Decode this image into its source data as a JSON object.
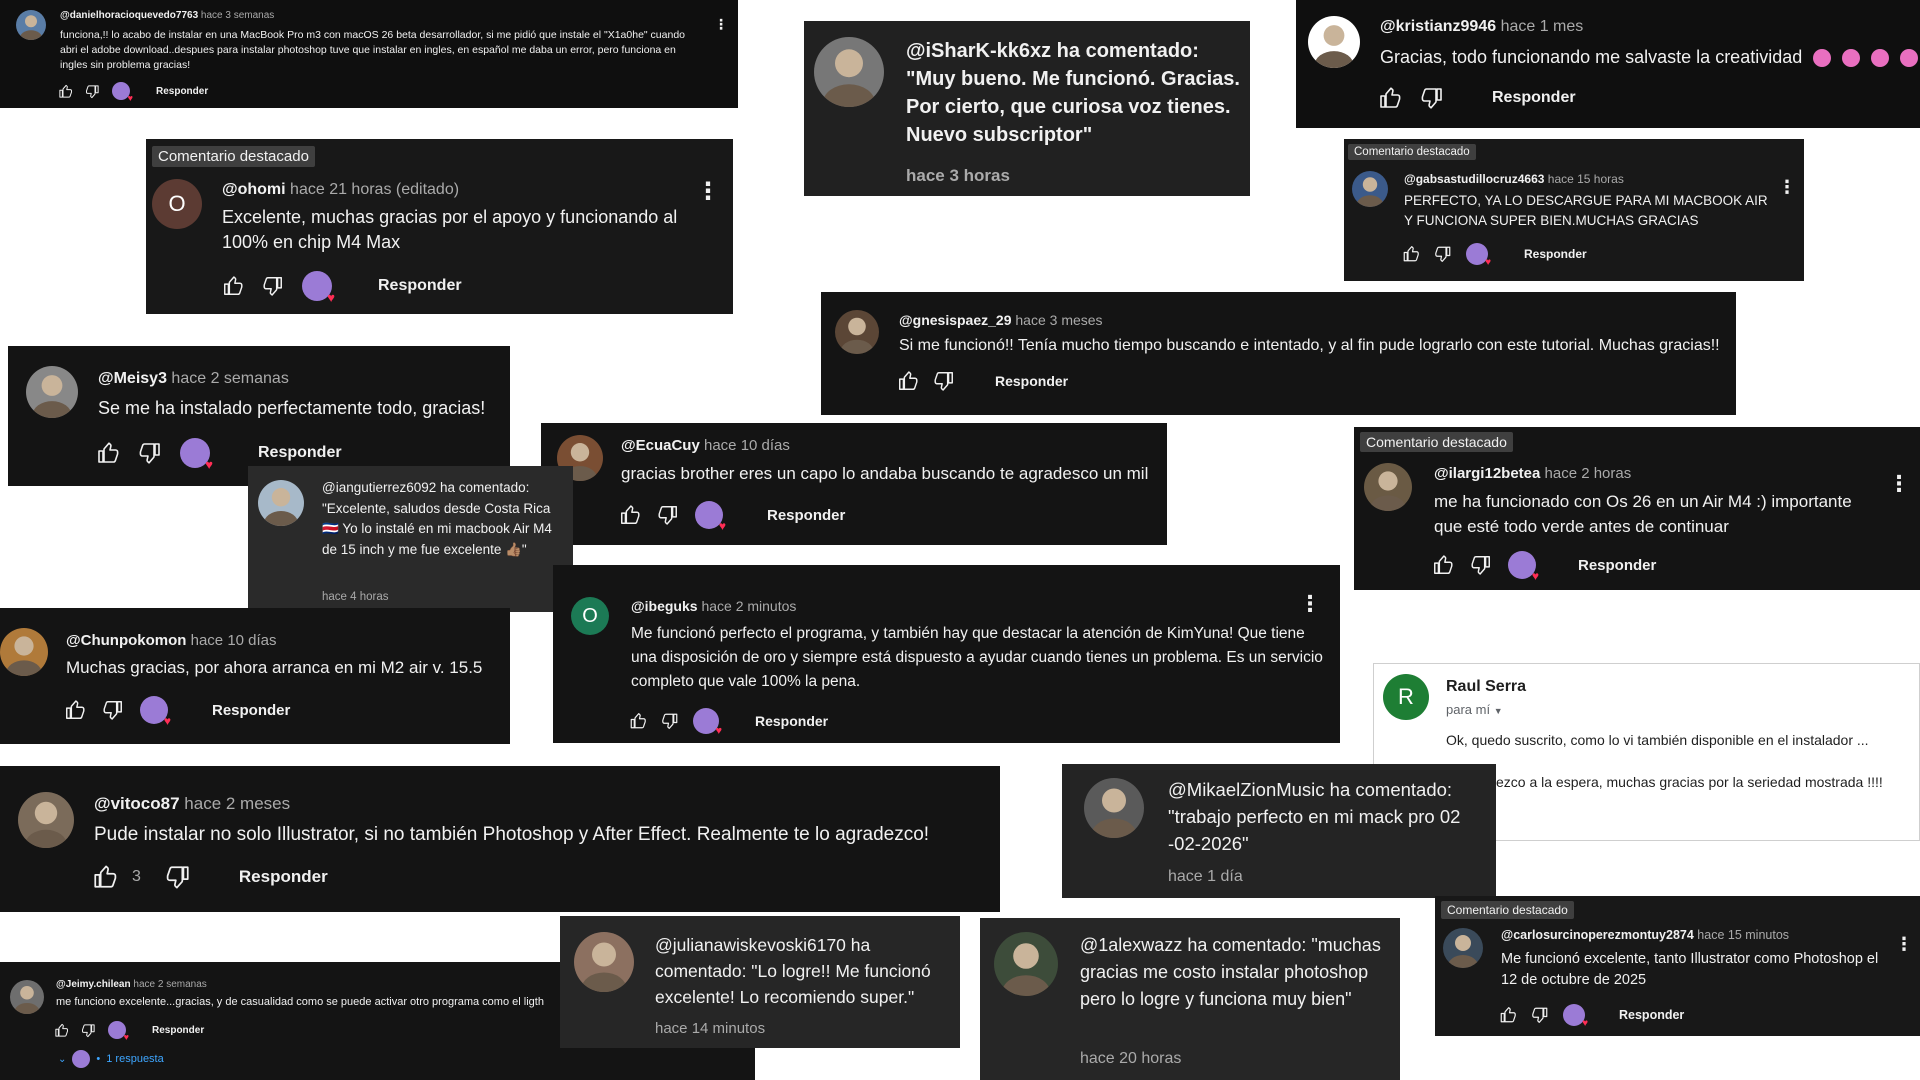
{
  "reply_label": "Responder",
  "featured_label": "Comentario destacado",
  "colors": {
    "card_bg": "#0f0f0f",
    "card_gray": "#212121",
    "time_gray": "#aaaaaa",
    "link_blue": "#3ea6ff",
    "badge_bg": "#3f3f3f"
  },
  "comments": {
    "c1": {
      "user": "@danielhoracioquevedo7763",
      "time": "hace 3 semanas",
      "text": "funciona,!! lo acabo de instalar en una MacBook Pro m3 con macOS 26 beta desarrollador, si me pidió que instale el \"X1a0he\" cuando abri el adobe download..despues para instalar photoshop tuve que instalar en ingles, en español me daba un error, pero funciona en ingles sin problema gracias!"
    },
    "c2": {
      "user": "@iSharK-kk6xz ha comentado: \"Muy bueno. Me funcionó. Gracias. Por cierto, que curiosa voz tienes. Nuevo subscriptor\"",
      "time": "hace 3 horas"
    },
    "c3": {
      "user": "@kristianz9946",
      "time": "hace 1 mes",
      "text": "Gracias, todo funcionando me salvaste la creatividad"
    },
    "c4": {
      "badge": "Comentario destacado",
      "avatar_letter": "O",
      "user": "@ohomi",
      "time": "hace 21 horas (editado)",
      "text": "Excelente, muchas gracias por el apoyo y funcionando al 100% en chip M4 Max"
    },
    "c5": {
      "badge": "Comentario destacado",
      "user": "@gabsastudillocruz4663",
      "time": "hace 15 horas",
      "text": "PERFECTO, YA LO DESCARGUE PARA MI MACBOOK AIR Y FUNCIONA SUPER BIEN.MUCHAS GRACIAS"
    },
    "c6": {
      "user": "@gnesispaez_29",
      "time": "hace 3 meses",
      "text": "Si me funcionó!! Tenía mucho tiempo buscando e intentado, y al fin pude lograrlo con este tutorial. Muchas gracias!!"
    },
    "c7": {
      "user": "@Meisy3",
      "time": "hace 2 semanas",
      "text": "Se me ha instalado perfectamente todo, gracias!"
    },
    "c8": {
      "text": "@iangutierrez6092 ha comentado: \"Excelente, saludos desde Costa Rica 🇨🇷 Yo lo instalé en mi macbook Air M4 de 15 inch y me fue excelente 👍🏽\"",
      "time": "hace 4 horas"
    },
    "c9": {
      "user": "@EcuaCuy",
      "time": "hace 10 días",
      "text": "gracias brother eres un capo lo andaba buscando te agradesco un mil"
    },
    "c10": {
      "badge": "Comentario destacado",
      "user": "@ilargi12betea",
      "time": "hace 2 horas",
      "text": "me ha funcionado con Os 26 en un Air M4 :) importante que esté todo verde antes de continuar"
    },
    "c11": {
      "user": "@Chunpokomon",
      "time": "hace 10 días",
      "text": "Muchas gracias, por ahora arranca en mi M2 air v. 15.5"
    },
    "c12": {
      "avatar_letter": "O",
      "user": "@ibeguks",
      "time": "hace 2 minutos",
      "text": "Me funcionó perfecto el programa, y también hay que destacar la atención de KimYuna! Que tiene una disposición de oro y siempre está dispuesto a ayudar cuando tienes un problema. Es un servicio completo que vale 100% la pena."
    },
    "c13": {
      "avatar_letter": "R",
      "sender": "Raul Serra",
      "to": "para mí",
      "line1": "Ok, quedo suscrito, como lo vi también disponible en el instalador ...",
      "line2": "ezco a la espera, muchas gracias por la seriedad mostrada !!!!"
    },
    "c14": {
      "user": "@vitoco87",
      "time": "hace 2 meses",
      "text": "Pude instalar no solo Illustrator, si no también Photoshop y After Effect. Realmente te lo agradezco!",
      "likes": "3"
    },
    "c15": {
      "text": "@MikaelZionMusic ha comentado: \"trabajo perfecto en mi mack pro 02 -02-2026\"",
      "time": "hace 1 día"
    },
    "c16": {
      "user": "@Jeimy.chilean",
      "time": "hace 2 semanas",
      "text": "me funciono excelente...gracias, y de casualidad como se puede activar otro programa como el ligth",
      "replies": "1 respuesta",
      "dot": "•"
    },
    "c17": {
      "text": "@julianawiskevoski6170 ha comentado: \"Lo logre!! Me funcionó excelente! Lo recomiendo super.\"",
      "time": "hace 14 minutos"
    },
    "c18": {
      "text": "@1alexwazz ha comentado: \"muchas gracias me costo instalar photoshop pero lo logre y funciona muy bien\"",
      "time": "hace 20 horas"
    },
    "c19": {
      "badge": "Comentario destacado",
      "user": "@carlosurcinoperezmontuy2874",
      "time": "hace 15 minutos",
      "text": "Me funcionó excelente, tanto Illustrator como Photoshop el 12 de octubre de 2025"
    }
  }
}
